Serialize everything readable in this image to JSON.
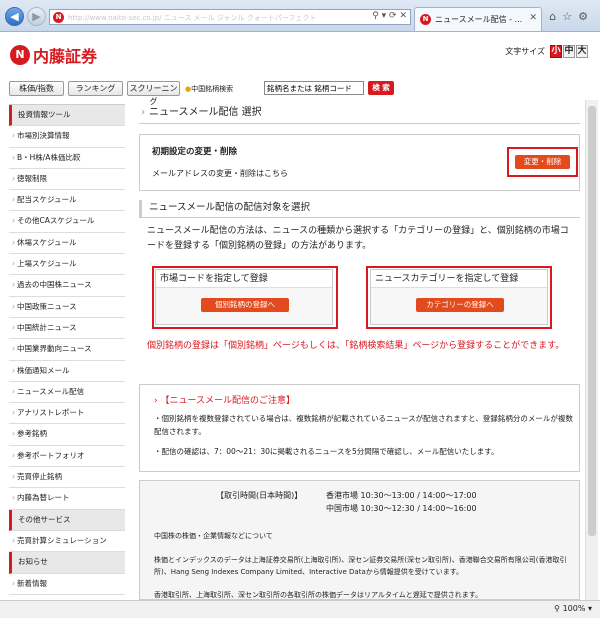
{
  "browser": {
    "address_ghost": "http://www.naito-sec.co.jp/ ニュース メール  ジャンル   クォートパーフェクト",
    "tab_title": "ニュースメール配信 - ...",
    "zoom": "100%"
  },
  "header": {
    "logo_text": "内藤証券",
    "fontsize_label": "文字サイズ",
    "fontsize_small": "小",
    "fontsize_medium": "中",
    "fontsize_large": "大"
  },
  "toolbar": {
    "btn1": "株価/指数",
    "btn2": "ランキング",
    "btn3": "スクリーニング",
    "search_label": "中国銘柄検索",
    "search_placeholder": "銘柄名または 銘柄コード",
    "search_button": "検 索"
  },
  "sidebar": {
    "items": [
      {
        "label": "投資情報ツール",
        "section": true
      },
      {
        "label": "市場別決算情報",
        "section": false
      },
      {
        "label": "B・H株/A株価比較",
        "section": false
      },
      {
        "label": "徳報制限",
        "section": false
      },
      {
        "label": "配当スケジュール",
        "section": false
      },
      {
        "label": "その他CAスケジュール",
        "section": false
      },
      {
        "label": "休場スケジュール",
        "section": false
      },
      {
        "label": "上場スケジュール",
        "section": false
      },
      {
        "label": "過去の中国株ニュース",
        "section": false
      },
      {
        "label": "中国政策ニュース",
        "section": false
      },
      {
        "label": "中国統計ニュース",
        "section": false
      },
      {
        "label": "中国業界動向ニュース",
        "section": false
      },
      {
        "label": "株価通知メール",
        "section": false
      },
      {
        "label": "ニュースメール配信",
        "section": false
      },
      {
        "label": "アナリストレポート",
        "section": false
      },
      {
        "label": "参考銘柄",
        "section": false
      },
      {
        "label": "参考ポートフォリオ",
        "section": false
      },
      {
        "label": "売買停止銘柄",
        "section": false
      },
      {
        "label": "内藤為替レート",
        "section": false
      },
      {
        "label": "その他サービス",
        "section": true
      },
      {
        "label": "売買計算シミュレーション",
        "section": false
      },
      {
        "label": "お知らせ",
        "section": true
      },
      {
        "label": "新着情報",
        "section": false
      },
      {
        "label": "手数料とリスクについて",
        "section": false
      }
    ]
  },
  "main": {
    "page_title": "ニュースメール配信 選択",
    "initial_heading": "初期設定の変更・削除",
    "initial_sub": "メールアドレスの変更・削除はこちら",
    "change_delete_button": "変更・削除",
    "section_title": "ニュースメール配信の配信対象を選択",
    "description": "ニュースメール配信の方法は、ニュースの種類から選択する「カテゴリーの登録」と、個別銘柄の市場コードを登録する「個別銘柄の登録」の方法があります。",
    "market_code_heading": "市場コードを指定して登録",
    "market_code_button": "個別銘柄の登録へ",
    "category_heading": "ニュースカテゴリーを指定して登録",
    "category_button": "カテゴリーの登録へ",
    "red_note": "個別銘柄の登録は「個別銘柄」ページもしくは、「銘柄検索結果」ページから登録することができます。",
    "caution_title": "【ニュースメール配信のご注意】",
    "caution_1": "個別銘柄を複数登録されている場合は、複数銘柄が記載されているニュースが配信されますと、登録銘柄分のメールが複数配信されます。",
    "caution_2": "配信の確認は、7：00〜21：30に掲載されるニュースを5分間隔で確認し、メール配信いたします。",
    "trading_label": "【取引時間(日本時間)】",
    "trading_hk": "香港市場 10:30〜13:00 / 14:00〜17:00",
    "trading_cn": "中国市場 10:30〜12:30 / 14:00〜16:00",
    "info_1": "中国株の株価・企業情報などについて",
    "info_2": "株価とインデックスのデータは上海証券交易所(上海取引所)、深セン証券交易所(深セン取引所)、香港聯合交易所有限公司(香港取引所)、Hang Seng Indexes Company Limited、Interactive Dataから情報提供を受けています。",
    "info_3": "香港取引所、上海取引所、深セン取引所の各取引所の株価データはリアルタイムと遅延で提供されます。"
  }
}
